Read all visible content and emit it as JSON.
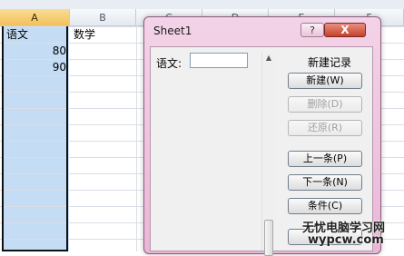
{
  "spreadsheet": {
    "columns": [
      "A",
      "B",
      "C",
      "D",
      "E",
      "F"
    ],
    "selected_column": "A",
    "cells": {
      "A1": "语文",
      "B1": "数学",
      "A2": "80",
      "A3": "90"
    }
  },
  "dialog": {
    "title": "Sheet1",
    "help_glyph": "?",
    "close_glyph": "X",
    "field_label": "语文:",
    "field_value": "",
    "record_status": "新建记录",
    "buttons": [
      {
        "label": "新建(W)",
        "enabled": true
      },
      {
        "label": "删除(D)",
        "enabled": false
      },
      {
        "label": "还原(R)",
        "enabled": false
      },
      {
        "label": "上一条(P)",
        "enabled": true
      },
      {
        "label": "下一条(N)",
        "enabled": true
      },
      {
        "label": "条件(C)",
        "enabled": true
      }
    ]
  },
  "watermark": {
    "line1": "无忧电脑学习网",
    "line2": "wypcw.com"
  },
  "colors": {
    "selection": "#c5dcf5",
    "dialog_frame": "#e9b7d6",
    "close_button": "#c6402c"
  }
}
